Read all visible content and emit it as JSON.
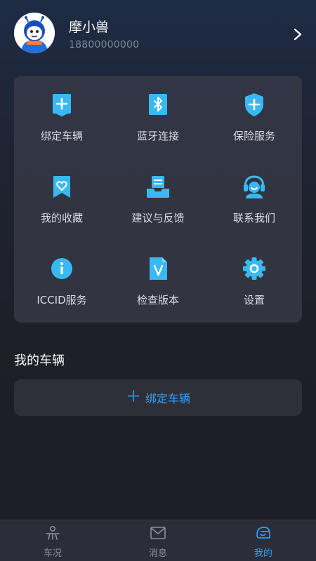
{
  "profile": {
    "name": "摩小兽",
    "phone": "18800000000",
    "avatar_icon": "mascot-avatar",
    "detail_icon": "chevron-right-icon"
  },
  "menu": [
    {
      "label": "绑定车辆",
      "icon": "plus-square-icon"
    },
    {
      "label": "蓝牙连接",
      "icon": "bluetooth-icon"
    },
    {
      "label": "保险服务",
      "icon": "shield-plus-icon"
    },
    {
      "label": "我的收藏",
      "icon": "heart-bookmark-icon"
    },
    {
      "label": "建议与反馈",
      "icon": "feedback-tray-icon"
    },
    {
      "label": "联系我们",
      "icon": "headset-agent-icon"
    },
    {
      "label": "ICCID服务",
      "icon": "info-circle-icon"
    },
    {
      "label": "检查版本",
      "icon": "version-file-icon"
    },
    {
      "label": "设置",
      "icon": "gear-icon"
    }
  ],
  "vehicles": {
    "title": "我的车辆",
    "bind_label": "绑定车辆",
    "bind_icon": "plus-icon"
  },
  "tabs": [
    {
      "label": "车况",
      "icon": "vehicle-status-icon",
      "active": false
    },
    {
      "label": "消息",
      "icon": "envelope-icon",
      "active": false
    },
    {
      "label": "我的",
      "icon": "helmet-icon",
      "active": true
    }
  ],
  "colors": {
    "accent": "#2e9ff7",
    "icon_blue": "#39b9f3",
    "card": "#3a3c4a",
    "background": "#1e1f27",
    "tabbar": "#2b2e38"
  }
}
